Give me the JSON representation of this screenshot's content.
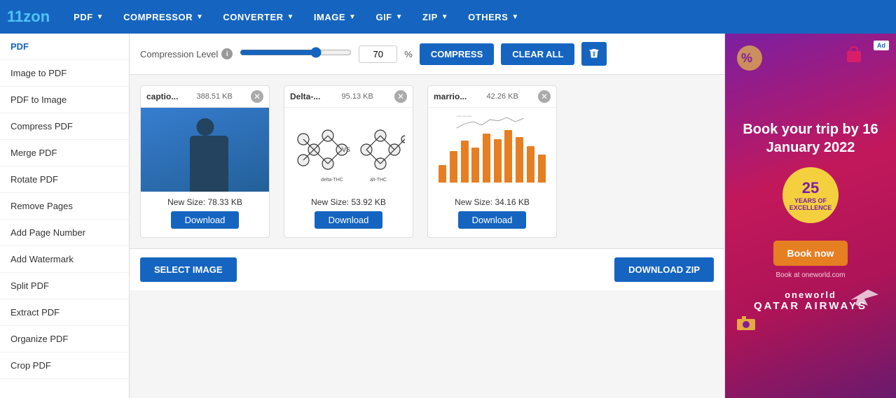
{
  "logo": {
    "text_start": "11z",
    "text_accent": "o",
    "text_end": "n"
  },
  "nav": {
    "items": [
      {
        "label": "PDF",
        "id": "pdf"
      },
      {
        "label": "COMPRESSOR",
        "id": "compressor"
      },
      {
        "label": "CONVERTER",
        "id": "converter"
      },
      {
        "label": "IMAGE",
        "id": "image"
      },
      {
        "label": "GIF",
        "id": "gif"
      },
      {
        "label": "ZIP",
        "id": "zip"
      },
      {
        "label": "OTHERS",
        "id": "others"
      }
    ]
  },
  "sidebar": {
    "items": [
      {
        "label": "PDF",
        "id": "pdf",
        "active": true
      },
      {
        "label": "Image to PDF",
        "id": "image-to-pdf"
      },
      {
        "label": "PDF to Image",
        "id": "pdf-to-image"
      },
      {
        "label": "Compress PDF",
        "id": "compress-pdf"
      },
      {
        "label": "Merge PDF",
        "id": "merge-pdf"
      },
      {
        "label": "Rotate PDF",
        "id": "rotate-pdf"
      },
      {
        "label": "Remove Pages",
        "id": "remove-pages"
      },
      {
        "label": "Add Page Number",
        "id": "add-page-number"
      },
      {
        "label": "Add Watermark",
        "id": "add-watermark"
      },
      {
        "label": "Split PDF",
        "id": "split-pdf"
      },
      {
        "label": "Extract PDF",
        "id": "extract-pdf"
      },
      {
        "label": "Organize PDF",
        "id": "organize-pdf"
      },
      {
        "label": "Crop PDF",
        "id": "crop-pdf"
      }
    ]
  },
  "toolbar": {
    "compression_label": "Compression Level",
    "compression_value": 70,
    "compress_btn": "COMPRESS",
    "clear_btn": "CLEAR ALL",
    "percent_sign": "%"
  },
  "files": [
    {
      "name": "captio...",
      "size": "388.51 KB",
      "new_size": "New Size: 78.33 KB",
      "download_label": "Download",
      "thumb_type": "person"
    },
    {
      "name": "Delta-...",
      "size": "95.13 KB",
      "new_size": "New Size: 53.92 KB",
      "download_label": "Download",
      "thumb_type": "molecule"
    },
    {
      "name": "marrio...",
      "size": "42.26 KB",
      "new_size": "New Size: 34.16 KB",
      "download_label": "Download",
      "thumb_type": "chart"
    }
  ],
  "chart_bars": [
    30,
    55,
    70,
    60,
    85,
    75,
    90,
    80,
    65,
    50
  ],
  "bottom": {
    "select_btn": "SELECT IMAGE",
    "download_zip_btn": "DOWNLOAD ZIP"
  },
  "ad": {
    "title": "Book your trip by 16 January 2022",
    "years": "25",
    "years_text": "YEARS OF EXCELLENCE",
    "book_btn": "Book now",
    "sub_text": "Book at oneworld.com",
    "logo": "oneworld",
    "airline": "QATAR\nAIRWAYS",
    "badge": "Ad"
  }
}
